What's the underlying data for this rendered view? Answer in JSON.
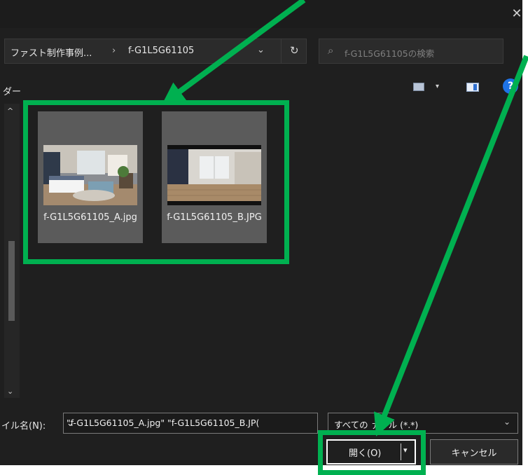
{
  "window": {
    "close_glyph": "✕"
  },
  "address_bar": {
    "crumb1": "ファスト制作事例...",
    "separator": "›",
    "crumb2": "f-G1L5G61105",
    "dropdown_glyph": "⌄",
    "refresh_glyph": "↻"
  },
  "search": {
    "icon": "⌕",
    "placeholder": "f-G1L5G61105の検索"
  },
  "toolbar": {
    "left_label": "ダー",
    "view_caret": "▾",
    "help": "?"
  },
  "nav": {
    "up": "^",
    "down": "⌄"
  },
  "files": [
    {
      "name": "f-G1L5G61105_A.jpg",
      "thumb": "bedroom-photo"
    },
    {
      "name": "f-G1L5G61105_B.JPG",
      "thumb": "empty-room-photo"
    }
  ],
  "bottom": {
    "filename_label": "イル名(N):",
    "filename_value": "\"f-G1L5G61105_A.jpg\" \"f-G1L5G61105_B.JP(",
    "filename_drop": "⌄",
    "type_value": "すべての ァイル (*.*)",
    "type_drop": "⌄",
    "open_label": "開く(O)",
    "open_caret": "▾",
    "cancel_label": "キャンセル"
  },
  "colors": {
    "highlight": "#00b050",
    "background": "#1f1f1f"
  }
}
